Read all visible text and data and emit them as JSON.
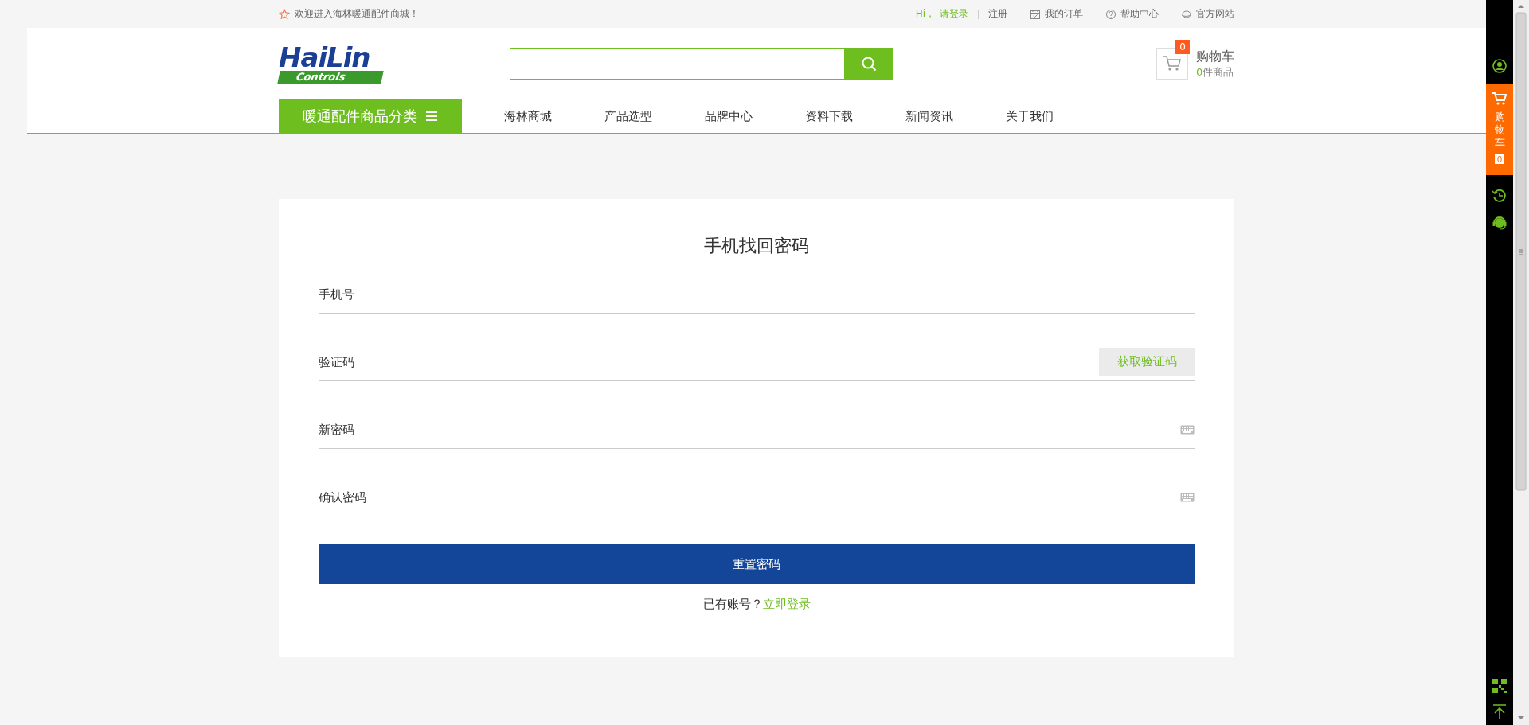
{
  "top_bar": {
    "welcome": "欢迎进入海林暖通配件商城！",
    "greeting": "Hi，",
    "login_link": "请登录",
    "register_link": "注册",
    "links": [
      {
        "label": "我的订单"
      },
      {
        "label": "帮助中心"
      },
      {
        "label": "官方网站"
      }
    ]
  },
  "header": {
    "logo_main": "HaiLin",
    "logo_sub": "Controls",
    "cart": {
      "badge": "0",
      "title": "购物车",
      "count": "0",
      "count_suffix": "件商品"
    }
  },
  "nav": {
    "category_button": "暖通配件商品分类",
    "items": [
      {
        "label": "海林商城"
      },
      {
        "label": "产品选型"
      },
      {
        "label": "品牌中心"
      },
      {
        "label": "资料下载"
      },
      {
        "label": "新闻资讯"
      },
      {
        "label": "关于我们"
      }
    ]
  },
  "form": {
    "title": "手机找回密码",
    "fields": [
      {
        "kind": "text",
        "placeholder": "手机号"
      },
      {
        "kind": "code",
        "placeholder": "验证码",
        "action": "获取验证码"
      },
      {
        "kind": "password",
        "placeholder": "新密码"
      },
      {
        "kind": "password",
        "placeholder": "确认密码"
      }
    ],
    "submit": "重置密码",
    "prompt": "已有账号？",
    "login_link": "立即登录"
  },
  "sidebar": {
    "cart_label": "购物车",
    "cart_count": "0"
  }
}
